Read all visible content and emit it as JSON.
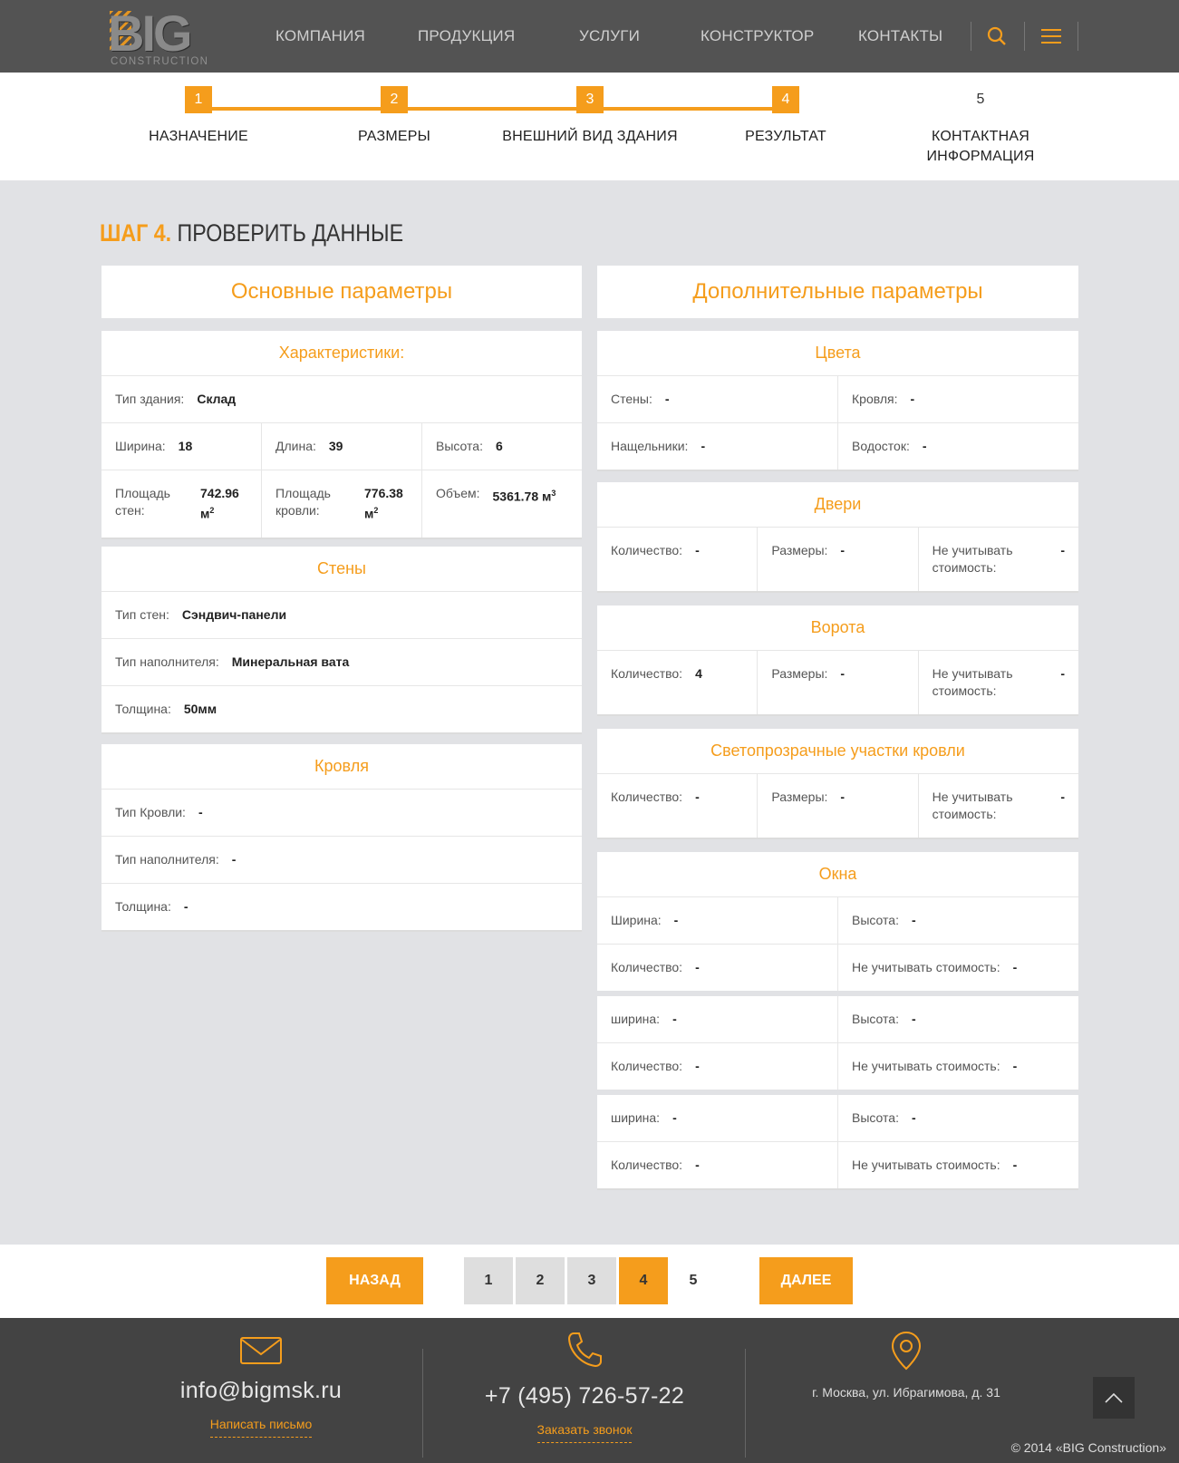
{
  "header": {
    "logo_big": "BIG",
    "logo_sub": "CONSTRUCTION",
    "nav": [
      "КОМПАНИЯ",
      "ПРОДУКЦИЯ",
      "УСЛУГИ",
      "КОНСТРУКТОР",
      "КОНТАКТЫ"
    ],
    "icons": [
      "search-icon",
      "menu-icon"
    ]
  },
  "steps": {
    "current": 4,
    "items": [
      {
        "num": "1",
        "label": "НАЗНАЧЕНИЕ"
      },
      {
        "num": "2",
        "label": "РАЗМЕРЫ"
      },
      {
        "num": "3",
        "label": "ВНЕШНИЙ ВИД ЗДАНИЯ"
      },
      {
        "num": "4",
        "label": "РЕЗУЛЬТАТ"
      },
      {
        "num": "5",
        "label_line1": "КОНТАКТНАЯ",
        "label_line2": "ИНФОРМАЦИЯ"
      }
    ]
  },
  "title": {
    "accent": "ШАГ 4.",
    "text": "ПРОВЕРИТЬ ДАННЫЕ"
  },
  "left": {
    "heading": "Основные параметры",
    "characteristics": {
      "title": "Характеристики:",
      "building_type": {
        "label": "Тип здания:",
        "value": "Склад"
      },
      "width": {
        "label": "Ширина:",
        "value": "18"
      },
      "length": {
        "label": "Длина:",
        "value": "39"
      },
      "height": {
        "label": "Высота:",
        "value": "6"
      },
      "wall_area": {
        "label1": "Площадь",
        "label2": "стен:",
        "value1": "742.96",
        "value2": "м",
        "sup": "2"
      },
      "roof_area": {
        "label1": "Площадь",
        "label2": "кровли:",
        "value1": "776.38",
        "value2": "м",
        "sup": "2"
      },
      "volume": {
        "label": "Объем:",
        "value": "5361.78 м",
        "sup": "3"
      }
    },
    "walls": {
      "title": "Стены",
      "type": {
        "label": "Тип стен:",
        "value": "Сэндвич-панели"
      },
      "filler": {
        "label": "Тип наполнителя:",
        "value": "Минеральная вата"
      },
      "thickness": {
        "label": "Толщина:",
        "value": "50мм"
      }
    },
    "roof": {
      "title": "Кровля",
      "type": {
        "label": "Тип Кровли:",
        "value": "-"
      },
      "filler": {
        "label": "Тип наполнителя:",
        "value": "-"
      },
      "thickness": {
        "label": "Толщина:",
        "value": "-"
      }
    }
  },
  "right": {
    "heading": "Дополнительные параметры",
    "colors": {
      "title": "Цвета",
      "walls": {
        "label": "Стены:",
        "value": "-"
      },
      "roof": {
        "label": "Кровля:",
        "value": "-"
      },
      "trims": {
        "label": "Нащельники:",
        "value": "-"
      },
      "gutter": {
        "label": "Водосток:",
        "value": "-"
      }
    },
    "doors": {
      "title": "Двери",
      "qty": {
        "label": "Количество:",
        "value": "-"
      },
      "size": {
        "label": "Размеры:",
        "value": "-"
      },
      "ignore": {
        "label1": "Не учитывать",
        "label2": "стоимость:",
        "value": "-"
      }
    },
    "gates": {
      "title": "Ворота",
      "qty": {
        "label": "Количество:",
        "value": "4"
      },
      "size": {
        "label": "Размеры:",
        "value": "-"
      },
      "ignore": {
        "label1": "Не учитывать",
        "label2": "стоимость:",
        "value": "-"
      }
    },
    "skylights": {
      "title": "Светопрозрачные участки кровли",
      "qty": {
        "label": "Количество:",
        "value": "-"
      },
      "size": {
        "label": "Размеры:",
        "value": "-"
      },
      "ignore": {
        "label1": "Не учитывать",
        "label2": "стоимость:",
        "value": "-"
      }
    },
    "windows": {
      "title": "Окна",
      "groups": [
        {
          "width_label": "Ширина:",
          "width": "-",
          "height_label": "Высота:",
          "height": "-",
          "qty_label": "Количество:",
          "qty": "-",
          "ignore_label": "Не учитывать стоимость:",
          "ignore": "-"
        },
        {
          "width_label": "ширина:",
          "width": "-",
          "height_label": "Высота:",
          "height": "-",
          "qty_label": "Количество:",
          "qty": "-",
          "ignore_label": "Не учитывать стоимость:",
          "ignore": "-"
        },
        {
          "width_label": "ширина:",
          "width": "-",
          "height_label": "Высота:",
          "height": "-",
          "qty_label": "Количество:",
          "qty": "-",
          "ignore_label": "Не учитывать стоимость:",
          "ignore": "-"
        }
      ]
    }
  },
  "pager": {
    "back": "НАЗАД",
    "next": "ДАЛЕЕ",
    "pages": [
      "1",
      "2",
      "3",
      "4",
      "5"
    ],
    "active": "4"
  },
  "footer": {
    "email": "info@bigmsk.ru",
    "email_link": "Написать письмо",
    "phone": "+7 (495) 726-57-22",
    "phone_link": "Заказать звонок",
    "address": "г. Москва, ул. Ибрагимова, д. 31",
    "copyright": "© 2014 «BIG Construction»"
  },
  "colors": {
    "accent": "#f59d1c",
    "header_bg": "#535353",
    "footer_bg": "#434343",
    "page_bg": "#e1e2e5"
  }
}
